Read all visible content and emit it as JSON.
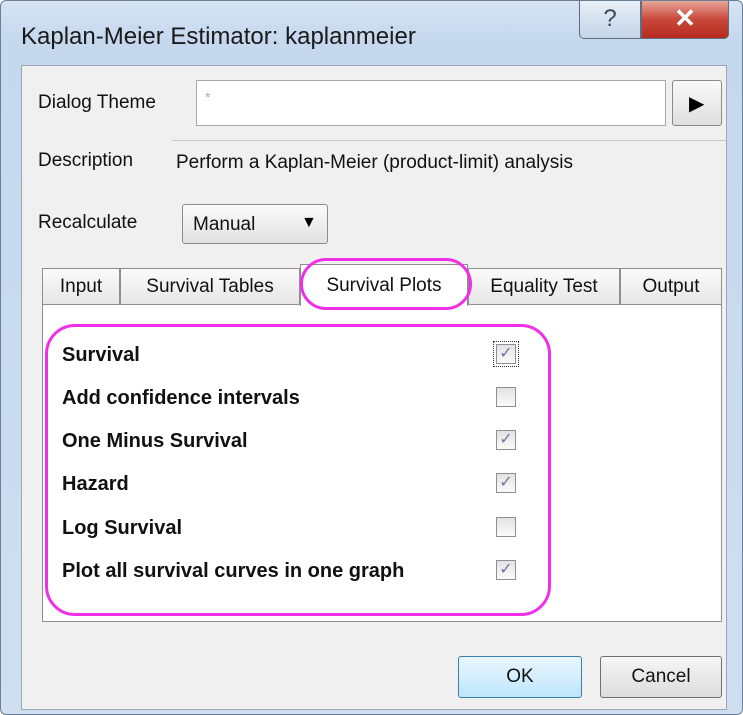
{
  "window": {
    "title": "Kaplan-Meier Estimator: kaplanmeier",
    "help_glyph": "?",
    "close_glyph": "✕"
  },
  "dialog_theme": {
    "label": "Dialog Theme",
    "value": "*"
  },
  "description": {
    "label": "Description",
    "value": "Perform a Kaplan-Meier (product-limit) analysis"
  },
  "recalculate": {
    "label": "Recalculate",
    "value": "Manual"
  },
  "tabs": [
    {
      "label": "Input"
    },
    {
      "label": "Survival Tables"
    },
    {
      "label": "Survival Plots"
    },
    {
      "label": "Equality Test"
    },
    {
      "label": "Output"
    }
  ],
  "options": [
    {
      "label": "Survival",
      "checked": true
    },
    {
      "label": "Add confidence intervals",
      "checked": false
    },
    {
      "label": "One Minus Survival",
      "checked": true
    },
    {
      "label": "Hazard",
      "checked": true
    },
    {
      "label": "Log Survival",
      "checked": false
    },
    {
      "label": "Plot all survival curves in one graph",
      "checked": true
    }
  ],
  "buttons": {
    "ok": "OK",
    "cancel": "Cancel"
  },
  "colors": {
    "highlight": "#f030e8",
    "title_bar": "#c5d8ee",
    "close_red": "#c8473a"
  }
}
